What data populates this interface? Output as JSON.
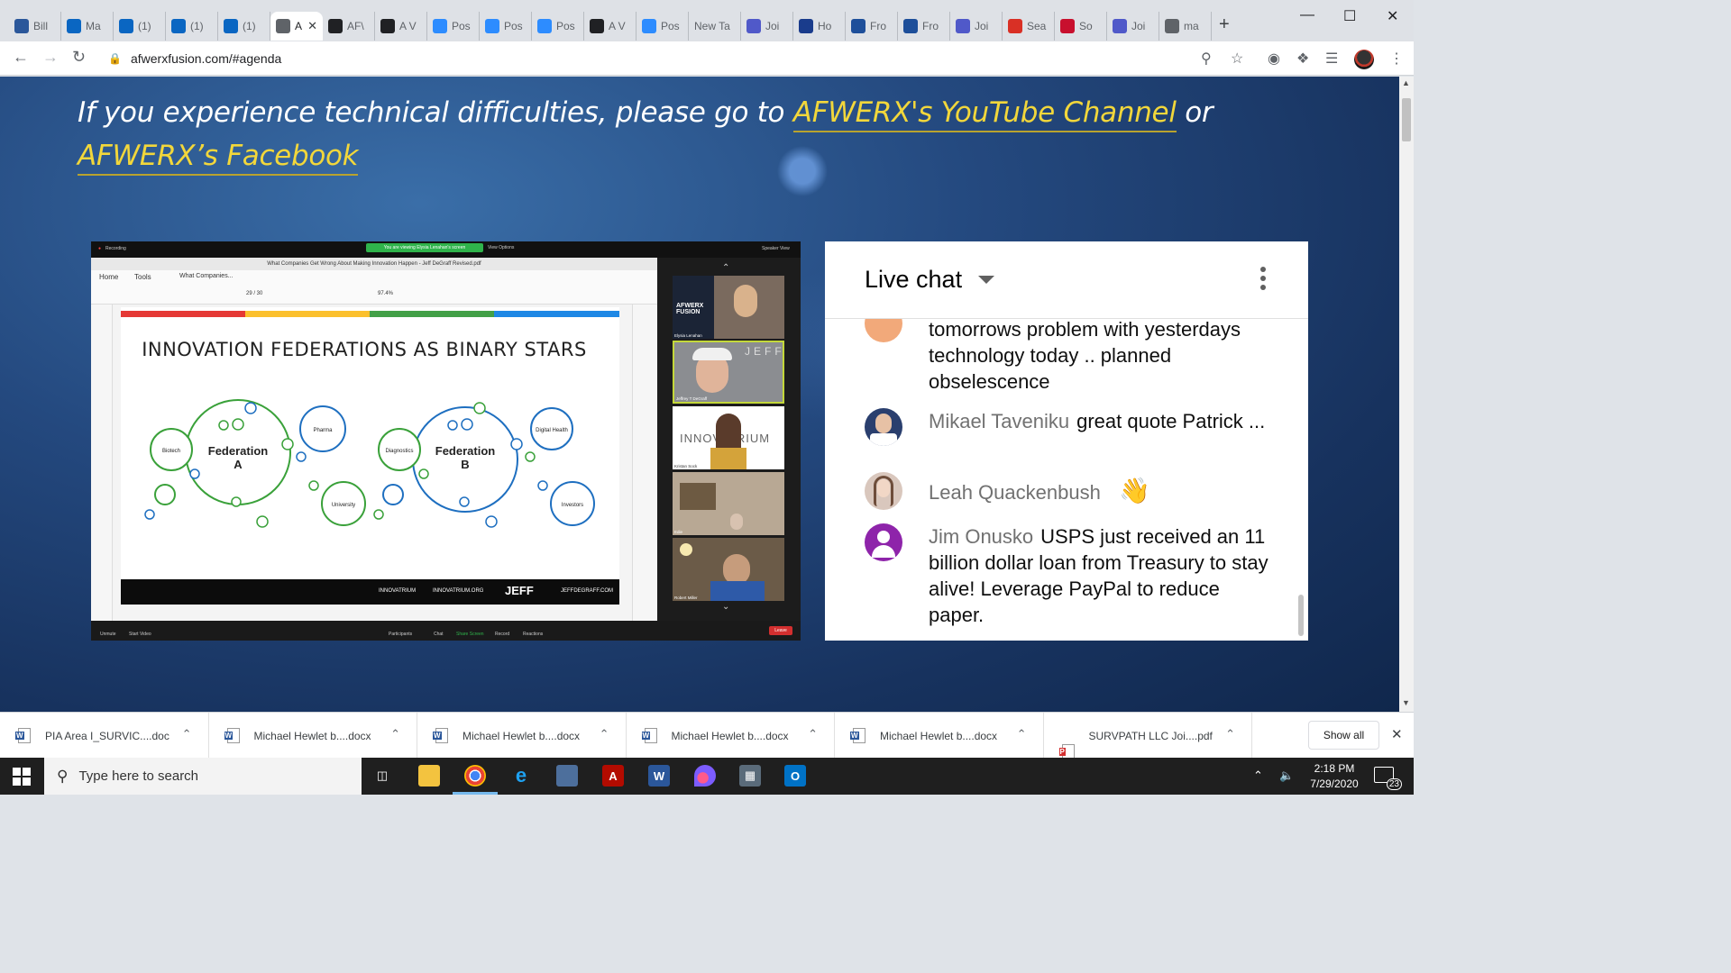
{
  "browser": {
    "tabs": [
      {
        "label": "Bill",
        "icon": "word-icon",
        "color": "#2b579a"
      },
      {
        "label": "Ma",
        "icon": "circle-icon",
        "color": "#0a66c2"
      },
      {
        "label": "(1)",
        "icon": "linkedin-icon",
        "color": "#0a66c2"
      },
      {
        "label": "(1)",
        "icon": "linkedin-icon",
        "color": "#0a66c2"
      },
      {
        "label": "(1)",
        "icon": "linkedin-icon",
        "color": "#0a66c2"
      },
      {
        "label": "A",
        "icon": "speaker-icon",
        "color": "#5f6368",
        "active": true
      },
      {
        "label": "AF\\",
        "icon": "satellite-icon",
        "color": "#202124"
      },
      {
        "label": "A V",
        "icon": "satellite-icon",
        "color": "#202124"
      },
      {
        "label": "Pos",
        "icon": "zoom-icon",
        "color": "#2d8cff"
      },
      {
        "label": "Pos",
        "icon": "zoom-icon",
        "color": "#2d8cff"
      },
      {
        "label": "Pos",
        "icon": "zoom-icon",
        "color": "#2d8cff"
      },
      {
        "label": "A V",
        "icon": "satellite-icon",
        "color": "#202124"
      },
      {
        "label": "Pos",
        "icon": "zoom-icon",
        "color": "#2d8cff"
      },
      {
        "label": "New Ta",
        "icon": "",
        "color": ""
      },
      {
        "label": "Joi",
        "icon": "teams-icon",
        "color": "#5059c9"
      },
      {
        "label": "Ho",
        "icon": "sv-icon",
        "color": "#1a3c8c"
      },
      {
        "label": "Fro",
        "icon": "doc-icon",
        "color": "#1e4f9a"
      },
      {
        "label": "Fro",
        "icon": "doc-icon",
        "color": "#1e4f9a"
      },
      {
        "label": "Joi",
        "icon": "teams-icon",
        "color": "#5059c9"
      },
      {
        "label": "Sea",
        "icon": "gmail-icon",
        "color": "#d93025"
      },
      {
        "label": "So",
        "icon": "heart-icon",
        "color": "#c8102e"
      },
      {
        "label": "Joi",
        "icon": "teams-icon",
        "color": "#5059c9"
      },
      {
        "label": "ma",
        "icon": "globe-icon",
        "color": "#5f6368"
      }
    ],
    "url": "afwerxfusion.com/#agenda"
  },
  "page": {
    "notice_prefix": "If you experience technical difficulties, please go to",
    "link_youtube": "AFWERX's YouTube Channel",
    "notice_or": "or",
    "link_facebook": "AFWERX’s Facebook"
  },
  "zoom": {
    "recording": "Recording",
    "share_banner": "You are viewing Elysia Lenahan's screen",
    "view_options": "View Options",
    "speaker_view": "Speaker View",
    "pdf_title": "What Companies Get Wrong About Making Innovation Happen - Jeff DeGraff Revised.pdf",
    "pdf_menu": [
      "Home",
      "Tools",
      "What Companies..."
    ],
    "page_indicator": "29 / 30",
    "zoom_level": "97.4%",
    "slide": {
      "title": "INNOVATION FEDERATIONS AS BINARY STARS",
      "fed_a": [
        "Federation",
        "A"
      ],
      "fed_b": [
        "Federation",
        "B"
      ],
      "nodes": [
        "Biotech",
        "Pharma",
        "University",
        "Diagnostics",
        "Digital Health",
        "Investors"
      ],
      "footer": [
        "INNOVATRIUM",
        "INNOVATRIUM.ORG",
        "JEFF",
        "JEFFDEGRAFF.COM"
      ]
    },
    "participants": [
      {
        "name": "Elysia Lenahan",
        "logo": "AFWERX FUSION"
      },
      {
        "name": "Jeffrey T DeGraff",
        "logo": "JEFF"
      },
      {
        "name": "Kristan Sock",
        "logo": "INNOVATRIUM"
      },
      {
        "name": "Edie",
        "logo": ""
      },
      {
        "name": "Robert Miller",
        "logo": ""
      }
    ],
    "controls": [
      "Unmute",
      "Start Video",
      "Participants",
      "Chat",
      "Share Screen",
      "Record",
      "Reactions"
    ],
    "leave": "Leave"
  },
  "chat": {
    "title": "Live chat",
    "messages": [
      {
        "author": "",
        "text": "tomorrows problem with yesterdays technology today .. planned obselescence",
        "avatar_color": "#f2a97a"
      },
      {
        "author": "Mikael Taveniku",
        "text": "great quote Patrick ...",
        "avatar_color": "#2a3f6e"
      },
      {
        "author": "Leah Quackenbush",
        "text": "👋",
        "avatar_color": "#d9c7bd"
      },
      {
        "author": "Jim Onusko",
        "text": "USPS just received an 11 billion dollar loan from Treasury to stay alive! Leverage PayPal to reduce paper.",
        "avatar_color": "#8e24aa"
      }
    ]
  },
  "downloads": {
    "items": [
      "PIA Area I_SURVIC....doc",
      "Michael Hewlet b....docx",
      "Michael Hewlet b....docx",
      "Michael Hewlet b....docx",
      "Michael Hewlet b....docx",
      "SURVPATH LLC Joi....pdf"
    ],
    "show_all": "Show all"
  },
  "taskbar": {
    "search_placeholder": "Type here to search",
    "time": "2:18 PM",
    "date": "7/29/2020",
    "notifications": "23"
  }
}
